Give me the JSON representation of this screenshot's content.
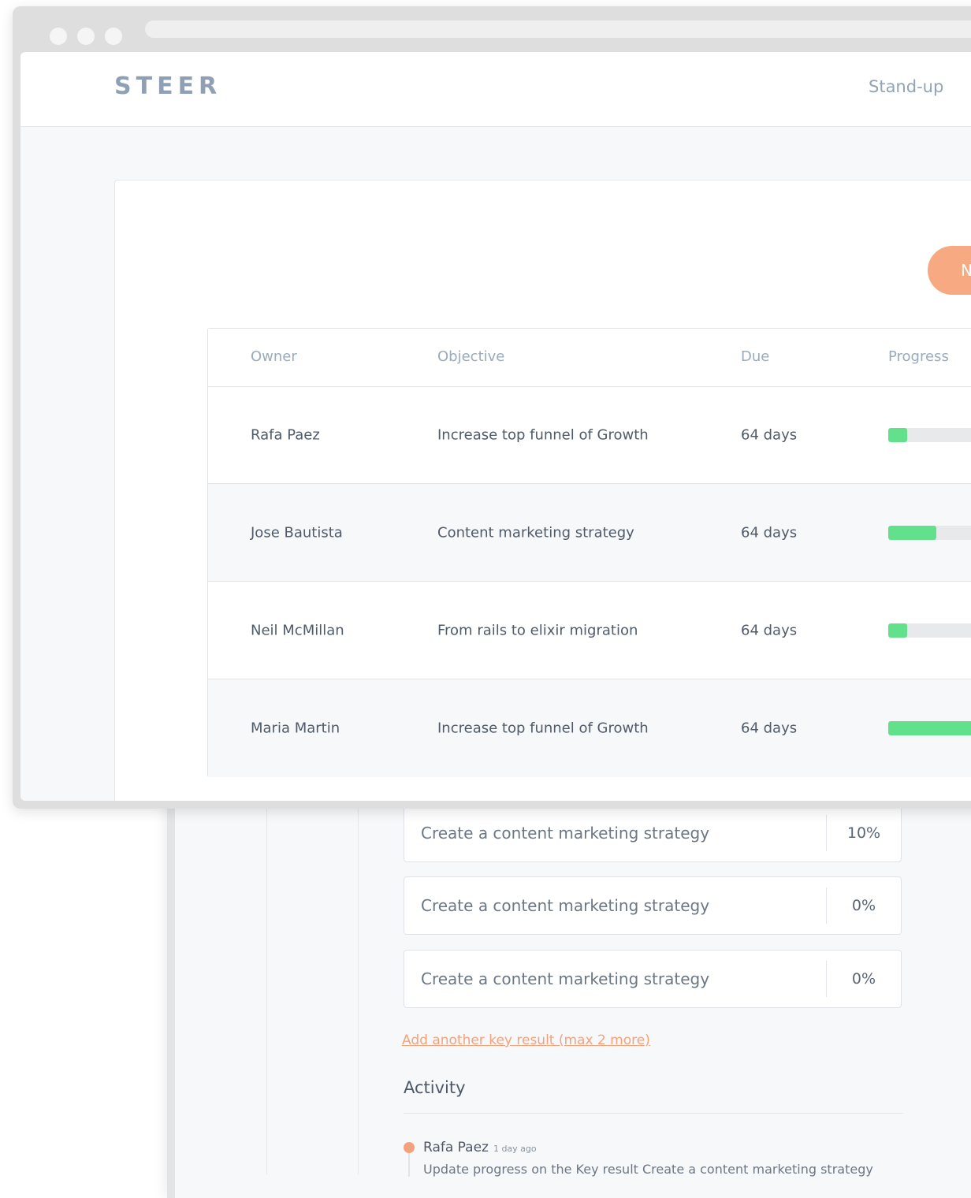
{
  "app": {
    "logo": "STEER",
    "nav_standup": "Stand-up",
    "new_button_label": "N"
  },
  "table": {
    "headers": {
      "owner": "Owner",
      "objective": "Objective",
      "due": "Due",
      "progress": "Progress"
    },
    "rows": [
      {
        "owner": "Rafa Paez",
        "objective": "Increase top funnel of Growth",
        "due": "64 days",
        "progress": 0.15
      },
      {
        "owner": "Jose Bautista",
        "objective": "Content marketing strategy",
        "due": "64 days",
        "progress": 0.38
      },
      {
        "owner": "Neil McMillan",
        "objective": "From rails to elixir migration",
        "due": "64 days",
        "progress": 0.15
      },
      {
        "owner": "Maria Martin",
        "objective": "Increase top funnel of Growth",
        "due": "64 days",
        "progress": 1.0
      }
    ]
  },
  "key_results": [
    {
      "text": "Create a content marketing strategy",
      "percent": "10%"
    },
    {
      "text": "Create a content marketing strategy",
      "percent": "0%"
    },
    {
      "text": "Create a content marketing strategy",
      "percent": "0%"
    }
  ],
  "add_key_result_link": "Add another key result (max 2 more)",
  "activity": {
    "title": "Activity",
    "entries": [
      {
        "name": "Rafa Paez",
        "time": "1 day ago",
        "text": "Update progress on the Key result Create a content marketing strategy"
      }
    ]
  },
  "colors": {
    "accent": "#f7a982",
    "progress": "#63e08c",
    "logo": "#8fa0b5"
  }
}
